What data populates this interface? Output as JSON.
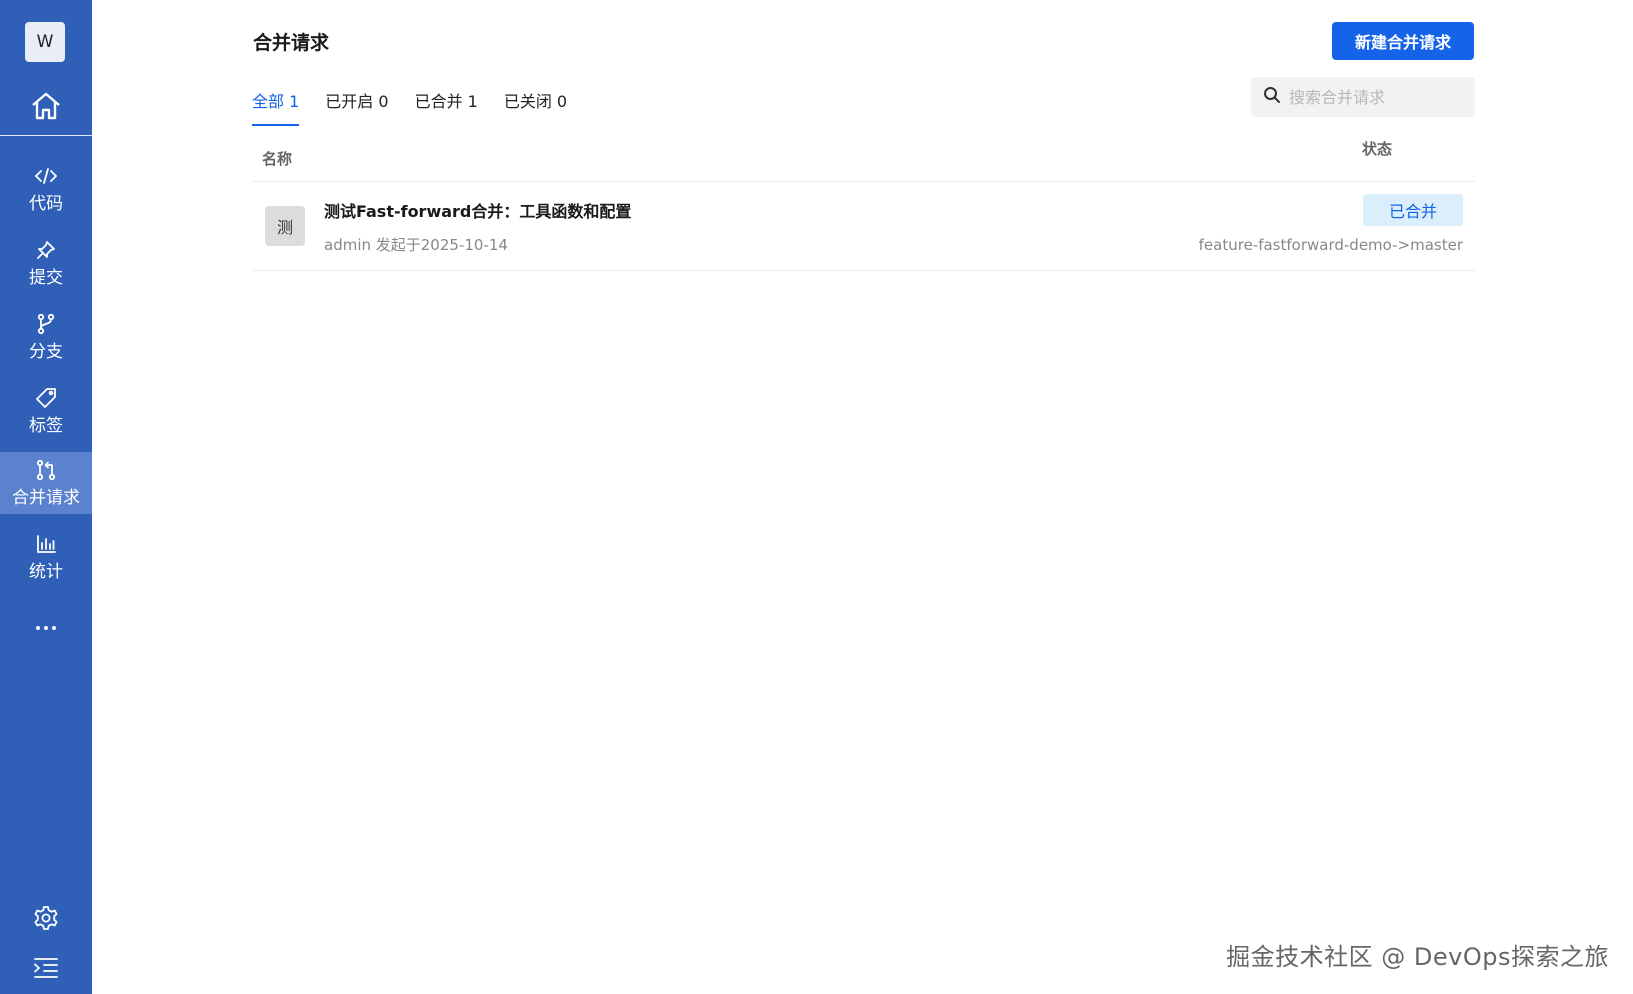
{
  "sidebar": {
    "avatar_text": "W",
    "items": [
      {
        "label": "代码",
        "icon": "code-icon"
      },
      {
        "label": "提交",
        "icon": "pin-icon"
      },
      {
        "label": "分支",
        "icon": "branch-icon"
      },
      {
        "label": "标签",
        "icon": "tag-icon"
      },
      {
        "label": "合并请求",
        "icon": "merge-request-icon",
        "active": true
      },
      {
        "label": "统计",
        "icon": "bar-chart-icon"
      }
    ],
    "bg_color": "#2f5fb7",
    "active_color": "#5b82cf"
  },
  "header": {
    "title": "合并请求",
    "new_button_label": "新建合并请求"
  },
  "tabs": [
    {
      "label": "全部 1",
      "active": true
    },
    {
      "label": "已开启 0"
    },
    {
      "label": "已合并 1"
    },
    {
      "label": "已关闭 0"
    }
  ],
  "search": {
    "placeholder": "搜索合并请求",
    "value": ""
  },
  "table": {
    "columns": {
      "name": "名称",
      "status": "状态"
    },
    "rows": [
      {
        "avatar_text": "测",
        "title": "测试Fast-forward合并：工具函数和配置",
        "meta": "admin 发起于2025-10-14",
        "status": "已合并",
        "branch": "feature-fastforward-demo->master"
      }
    ]
  },
  "watermark": "掘金技术社区 @ DevOps探索之旅",
  "accent_color": "#1463e8"
}
